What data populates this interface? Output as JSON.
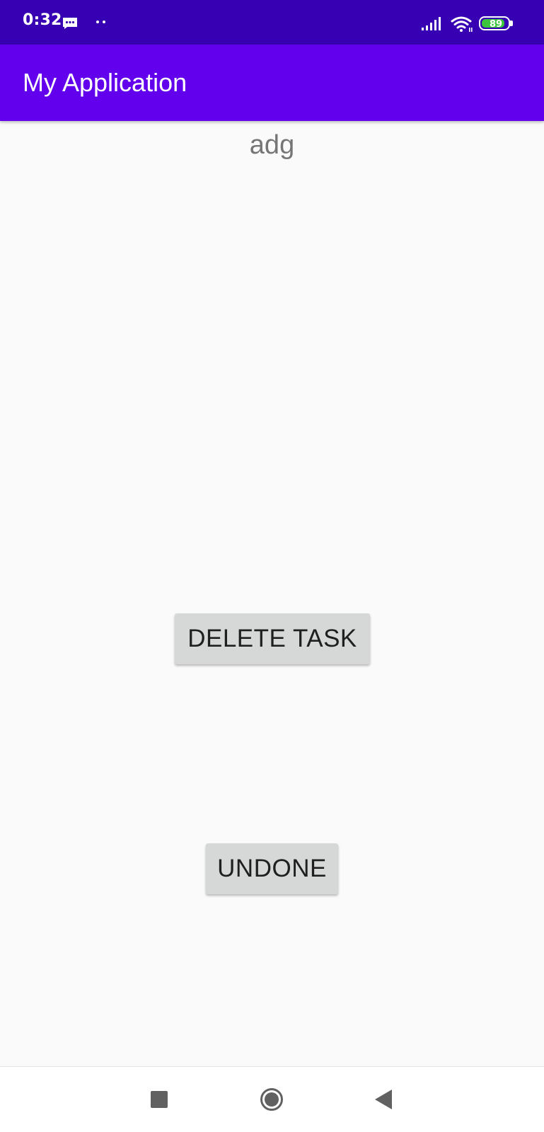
{
  "status_bar": {
    "time": "0:32",
    "icons": [
      "message-icon",
      "dots-icon",
      "signal-icon",
      "wifi-icon",
      "battery-icon"
    ],
    "battery_level": "89",
    "battery_fraction": 0.89
  },
  "app_bar": {
    "title": "My Application"
  },
  "task": {
    "name": "adg"
  },
  "buttons": {
    "delete_label": "DELETE TASK",
    "undone_label": "UNDONE"
  },
  "nav_bar": {
    "icons": [
      "recent-apps-icon",
      "home-icon",
      "back-icon"
    ]
  },
  "colors": {
    "status_bar": "#3700b3",
    "app_bar": "#6200ee",
    "background": "#fafafa",
    "button": "#d6d7d7",
    "battery_fill": "#3cc43c"
  }
}
